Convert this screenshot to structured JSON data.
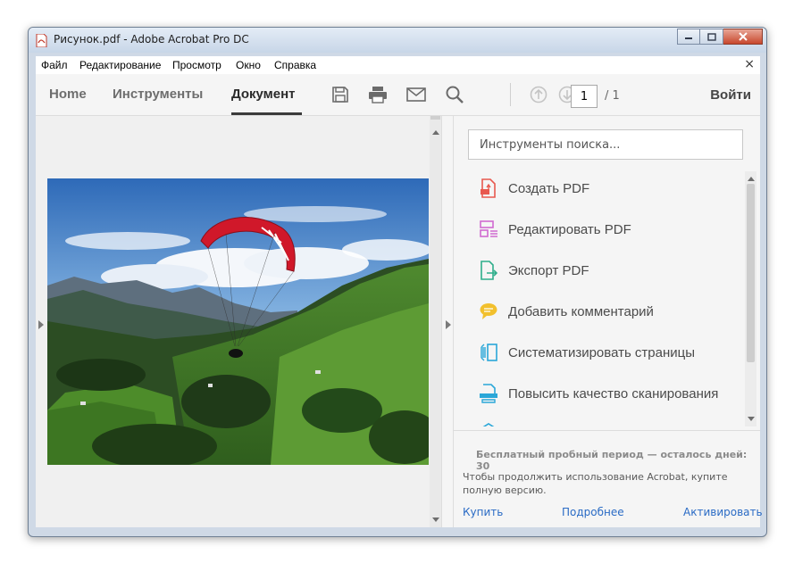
{
  "window": {
    "title": "Рисунок.pdf - Adobe Acrobat Pro DC"
  },
  "menu": {
    "items": [
      "Файл",
      "Редактирование",
      "Просмотр",
      "Окно",
      "Справка"
    ],
    "close_symbol": "×"
  },
  "toolbar": {
    "tabs": [
      {
        "label": "Home",
        "active": false
      },
      {
        "label": "Инструменты",
        "active": false
      },
      {
        "label": "Документ",
        "active": true
      }
    ],
    "icons": [
      "save-icon",
      "print-icon",
      "email-icon",
      "search-icon",
      "page-up-icon",
      "page-down-icon"
    ],
    "page_current": "1",
    "page_total": "/ 1",
    "signin_label": "Войти"
  },
  "tools": {
    "search_placeholder": "Инструменты поиска...",
    "items": [
      {
        "label": "Создать PDF",
        "icon": "create-pdf-icon",
        "color": "#e8594f"
      },
      {
        "label": "Редактировать PDF",
        "icon": "edit-pdf-icon",
        "color": "#d06bd0"
      },
      {
        "label": "Экспорт PDF",
        "icon": "export-pdf-icon",
        "color": "#2fae8b"
      },
      {
        "label": "Добавить комментарий",
        "icon": "comment-icon",
        "color": "#f2c02d"
      },
      {
        "label": "Систематизировать страницы",
        "icon": "organize-pages-icon",
        "color": "#2aa7d8"
      },
      {
        "label": "Повысить качество сканирования",
        "icon": "enhance-scan-icon",
        "color": "#2aa7d8"
      }
    ]
  },
  "trial": {
    "title": "Бесплатный пробный период — осталось дней: 30",
    "body": "Чтобы продолжить использование Acrobat, купите полную версию.",
    "links": [
      "Купить",
      "Подробнее",
      "Активировать"
    ]
  },
  "colors": {
    "link": "#2a6bc5",
    "active_tab_underline": "#3b3b3b"
  }
}
